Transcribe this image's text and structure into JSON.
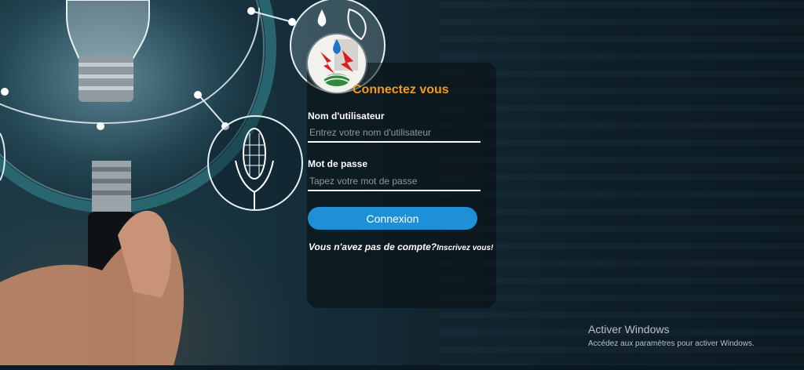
{
  "login": {
    "title": "Connectez vous",
    "username_label": "Nom d'utilisateur",
    "username_placeholder": "Entrez votre nom d'utilisateur",
    "username_value": "",
    "password_label": "Mot de passe",
    "password_placeholder": "Tapez votre mot de passe",
    "password_value": "",
    "submit_label": "Connexion",
    "signup_prompt": "Vous n'avez pas de compte?",
    "signup_link": "Inscrivez vous!"
  },
  "watermark": {
    "title": "Activer Windows",
    "subtitle": "Accédez aux paramètres pour activer Windows."
  },
  "colors": {
    "accent_title": "#f39a1e",
    "button": "#1e90d8",
    "panel": "rgba(8,14,18,0.55)"
  }
}
